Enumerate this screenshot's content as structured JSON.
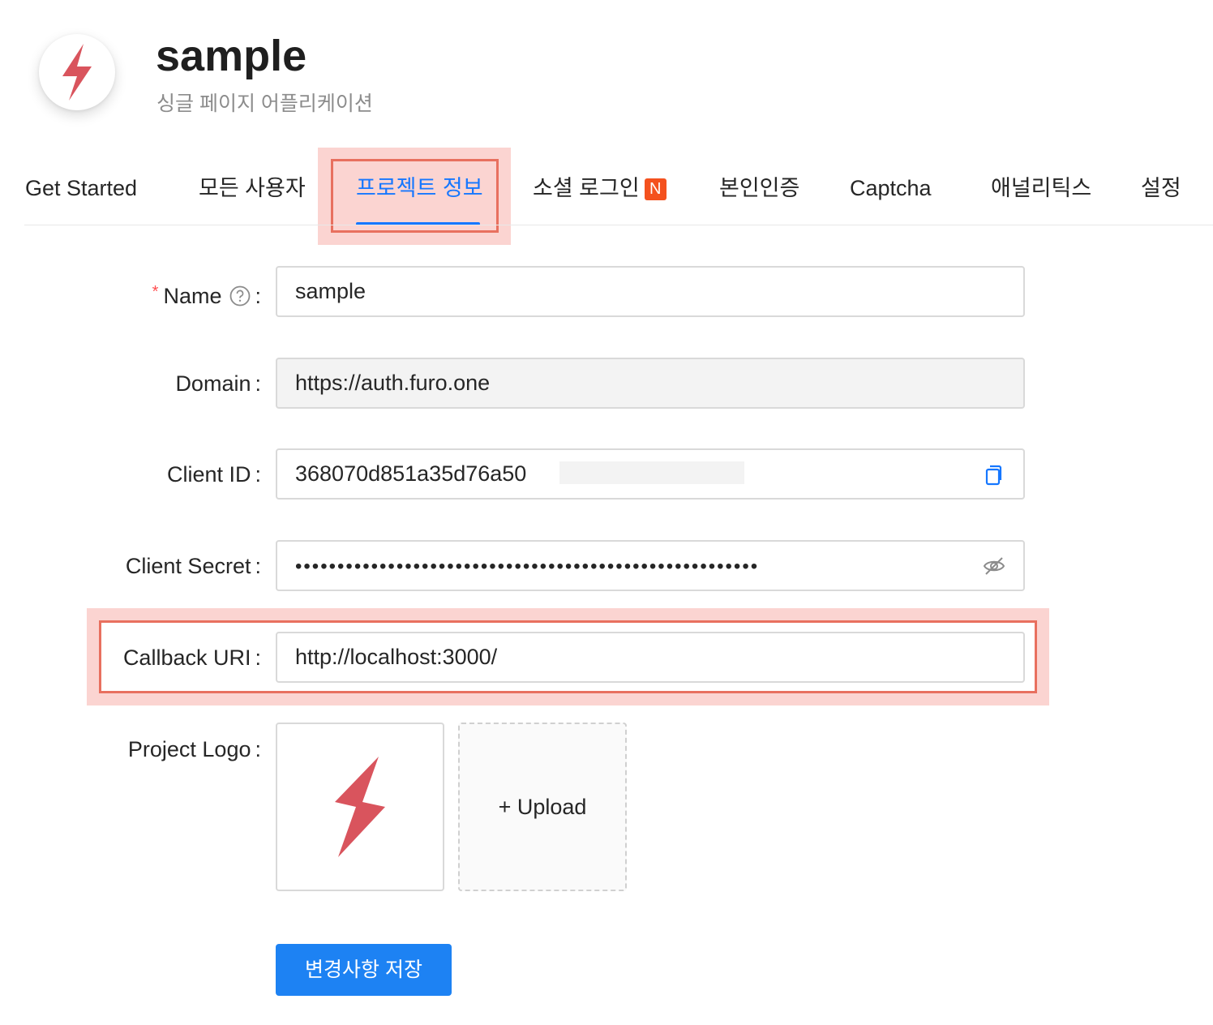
{
  "app": {
    "title": "sample",
    "subtitle": "싱글 페이지 어플리케이션"
  },
  "tabs": [
    {
      "label": "Get Started"
    },
    {
      "label": "모든 사용자"
    },
    {
      "label": "프로젝트 정보",
      "active": true
    },
    {
      "label": "소셜 로그인",
      "badge": "N"
    },
    {
      "label": "본인인증"
    },
    {
      "label": "Captcha"
    },
    {
      "label": "애널리틱스"
    },
    {
      "label": "설정"
    }
  ],
  "form": {
    "name": {
      "label": "Name",
      "colon": ":",
      "value": "sample",
      "required_mark": "*"
    },
    "domain": {
      "label": "Domain",
      "colon": ":",
      "value": "https://auth.furo.one"
    },
    "client_id": {
      "label": "Client ID",
      "colon": ":",
      "value": "368070d851a35d76a50",
      "icon": "copy-icon"
    },
    "client_secret": {
      "label": "Client Secret",
      "colon": ":",
      "value": "•••••••••••••••••••••••••••••••••••••••••••••••••••••••",
      "icon": "eye-invisible-icon"
    },
    "callback_uri": {
      "label": "Callback URI",
      "colon": ":",
      "value": "http://localhost:3000/"
    },
    "project_logo": {
      "label": "Project Logo",
      "colon": ":",
      "upload_label": "+ Upload"
    }
  },
  "save_button": "변경사항 저장",
  "colors": {
    "accent": "#1677ff",
    "button": "#1d82f3",
    "badge": "#f4511e",
    "logo": "#d9545d",
    "highlight": "#e8705f"
  }
}
